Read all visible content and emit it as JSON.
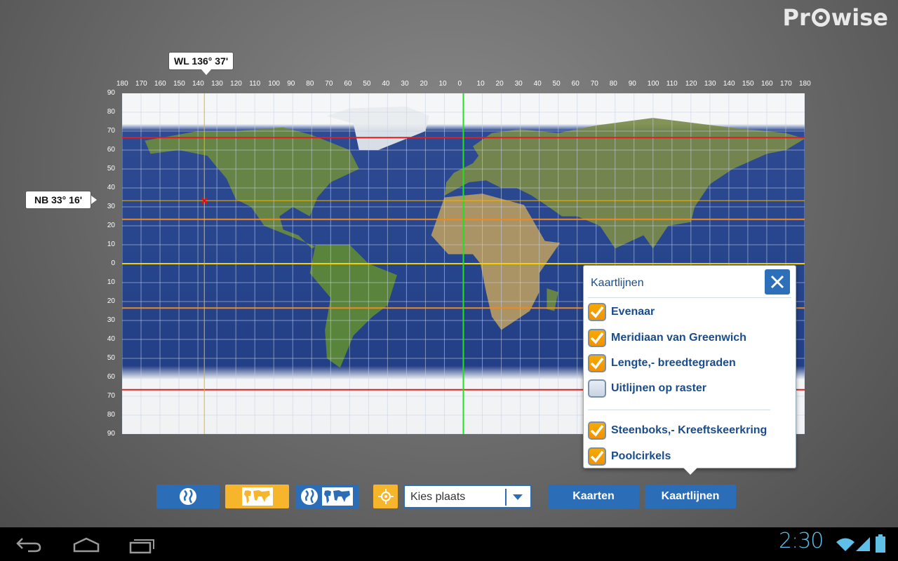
{
  "app": {
    "logo": "Pr◎wise",
    "logo_prefix": "Pr",
    "logo_suffix": "wise"
  },
  "map": {
    "longitude_scale": [
      "180",
      "170",
      "160",
      "150",
      "140",
      "130",
      "120",
      "110",
      "100",
      "90",
      "80",
      "70",
      "60",
      "50",
      "40",
      "30",
      "20",
      "10",
      "0",
      "10",
      "20",
      "30",
      "40",
      "50",
      "60",
      "70",
      "80",
      "90",
      "100",
      "110",
      "120",
      "130",
      "140",
      "150",
      "160",
      "170",
      "180"
    ],
    "latitude_scale": [
      "90",
      "80",
      "70",
      "60",
      "50",
      "40",
      "30",
      "20",
      "10",
      "0",
      "10",
      "20",
      "30",
      "40",
      "50",
      "60",
      "70",
      "80",
      "90"
    ],
    "longitude_readout": "WL  136° 37'",
    "latitude_readout": "NB  33° 16'",
    "marker": {
      "longitude": -136.62,
      "latitude": 33.27
    },
    "line_colors": {
      "equator": "#f5d000",
      "greenwich": "#22e022",
      "tropics": "#f08a1e",
      "polar_circles": "#e02020",
      "grid": "#c8d2e6",
      "cursor": "#f5b400"
    }
  },
  "panel": {
    "title": "Kaartlijnen",
    "close_icon": "close-icon",
    "options": [
      {
        "label": "Evenaar",
        "checked": true
      },
      {
        "label": "Meridiaan van Greenwich",
        "checked": true
      },
      {
        "label": "Lengte,- breedtegraden",
        "checked": true
      },
      {
        "label": "Uitlijnen op raster",
        "checked": false
      },
      {
        "label": "Steenboks,- Kreeftskeerkring",
        "checked": true
      },
      {
        "label": "Poolcirkels",
        "checked": true
      }
    ]
  },
  "toolbar": {
    "globe_button_icon": "globe-icon",
    "map_button_icon": "world-map-icon",
    "globe_map_button_icon": "globe-and-map-icon",
    "locate_icon": "crosshair-icon",
    "place_select_value": "Kies plaats",
    "maps_label": "Kaarten",
    "maplines_label": "Kaartlijnen",
    "colors": {
      "blue": "#2c6db7",
      "orange": "#f7b52b"
    }
  },
  "navbar": {
    "back_icon": "back-icon",
    "home_icon": "home-icon",
    "recents_icon": "recent-apps-icon",
    "time": "2:30",
    "wifi_icon": "wifi-icon",
    "signal_icon": "signal-icon",
    "battery_icon": "battery-icon"
  }
}
